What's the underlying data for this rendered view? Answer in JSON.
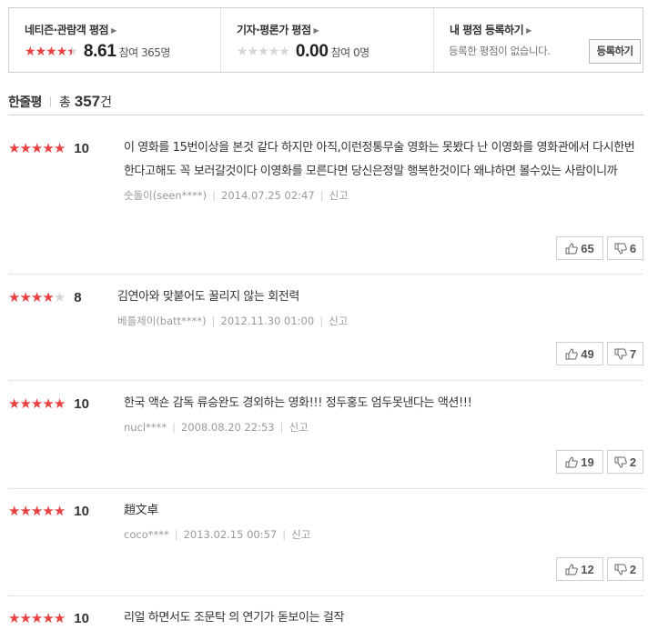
{
  "summary": {
    "netizen": {
      "title": "네티즌·관람객 평점",
      "score": "8.61",
      "participants": "참여 365명",
      "stars_filled": 4.3
    },
    "critic": {
      "title": "기자·평론가 평점",
      "score": "0.00",
      "participants": "참여 0명",
      "stars_filled": 0
    },
    "mine": {
      "title": "내 평점 등록하기",
      "empty_text": "등록한 평점이 없습니다.",
      "register_label": "등록하기"
    }
  },
  "list": {
    "title": "한줄평",
    "total_prefix": "총",
    "total_count": "357",
    "total_suffix": "건"
  },
  "reviews": [
    {
      "stars": 5,
      "score": "10",
      "text": "이 영화를 15번이상을 본것 같다 하지만 아직,이런정통무술 영화는 못봤다 난 이영화를 영화관에서 다시한번 한다고해도 꼭 보러갈것이다 이영화를 모른다면 당신은정말 행복한것이다 왜냐하면 볼수있는 사람이니까",
      "author": "숫돌이(seen****)",
      "date": "2014.07.25 02:47",
      "report": "신고",
      "likes": "65",
      "dislikes": "6"
    },
    {
      "stars": 4,
      "score": "8",
      "text": "김연아와 맞붙어도 꿀리지 않는 회전력",
      "author": "베틀제이(batt****)",
      "date": "2012.11.30 01:00",
      "report": "신고",
      "likes": "49",
      "dislikes": "7"
    },
    {
      "stars": 5,
      "score": "10",
      "text": "한국 액숀 감독 류승완도 경외하는 영화!!! 정두홍도 엄두못낸다는 액션!!!",
      "author": "nucl****",
      "date": "2008.08.20 22:53",
      "report": "신고",
      "likes": "19",
      "dislikes": "2"
    },
    {
      "stars": 5,
      "score": "10",
      "text": "趙文卓",
      "author": "coco****",
      "date": "2013.02.15 00:57",
      "report": "신고",
      "likes": "12",
      "dislikes": "2"
    },
    {
      "stars": 5,
      "score": "10",
      "text": "리얼 하면서도 조문탁 의 연기가 돋보이는 걸작",
      "author": "",
      "date": "",
      "report": "",
      "likes": "",
      "dislikes": ""
    }
  ],
  "icons": {
    "like": "thumbs-up-icon",
    "dislike": "thumbs-down-icon",
    "arrow": "caret-right-icon"
  },
  "colors": {
    "star_on": "#e84142",
    "star_off": "#d6d6d6"
  }
}
